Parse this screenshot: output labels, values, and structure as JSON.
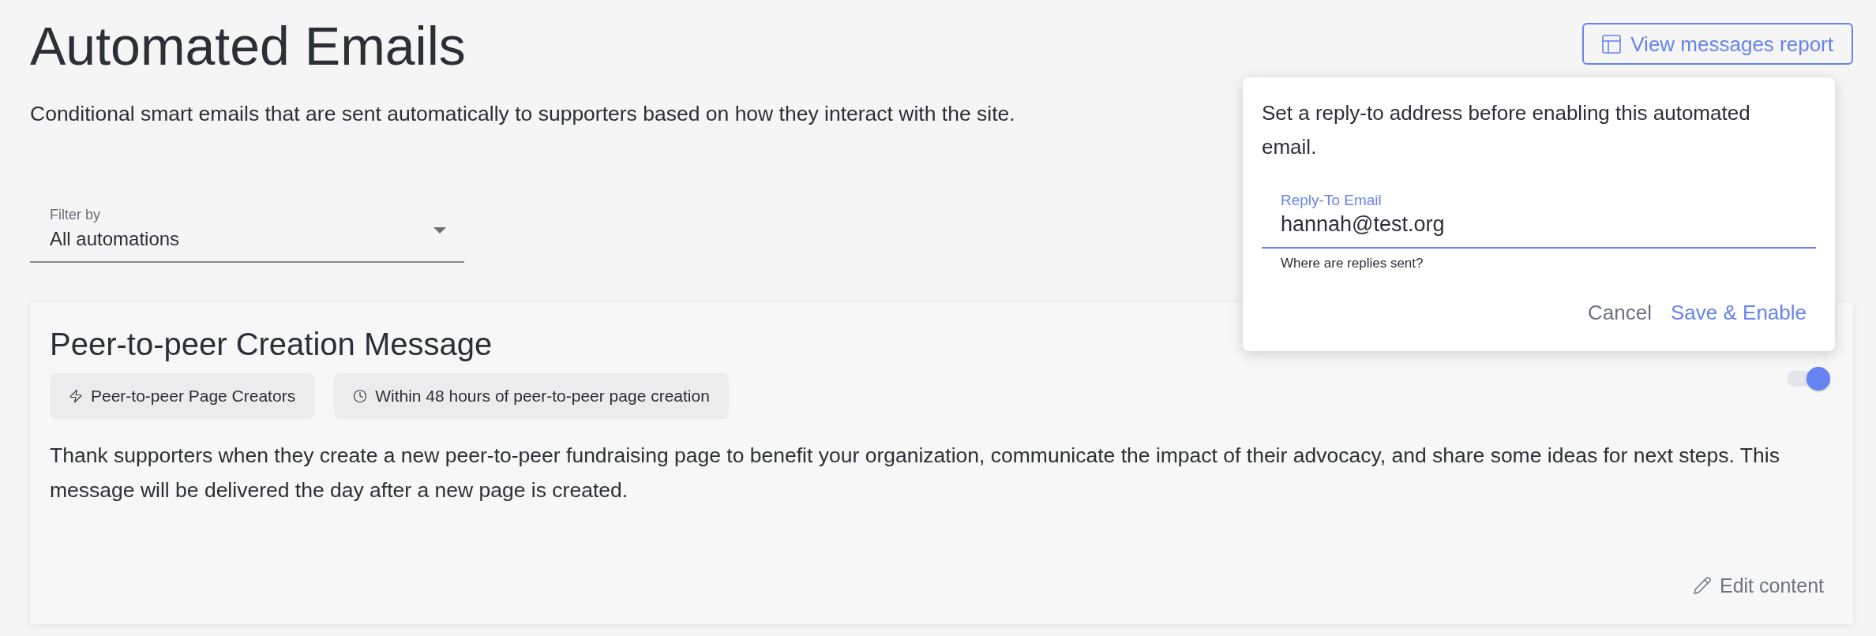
{
  "header": {
    "title": "Automated Emails",
    "subtitle": "Conditional smart emails that are sent automatically to supporters based on how they interact with the site.",
    "report_button": "View messages report"
  },
  "filter": {
    "label": "Filter by",
    "value": "All automations"
  },
  "automations": [
    {
      "title": "Peer-to-peer Creation Message",
      "tags": [
        {
          "kind": "audience",
          "label": "Peer-to-peer Page Creators"
        },
        {
          "kind": "timing",
          "label": "Within 48 hours of peer-to-peer page creation"
        }
      ],
      "on": true,
      "description": "Thank supporters when they create a new peer-to-peer fundraising page to benefit your organization, communicate the impact of their advocacy, and share some ideas for next steps. This message will be delivered the day after a new page is created.",
      "edit_button": "Edit content"
    }
  ],
  "reply_to_popover": {
    "message": "Set a reply-to address before enabling this automated email.",
    "field": {
      "label": "Reply-To Email",
      "value": "hannah@test.org",
      "helper": "Where are replies sent?",
      "focused": true
    },
    "buttons": [
      {
        "kind": "secondary",
        "label": "Cancel"
      },
      {
        "kind": "primary",
        "label": "Save & Enable"
      }
    ]
  }
}
